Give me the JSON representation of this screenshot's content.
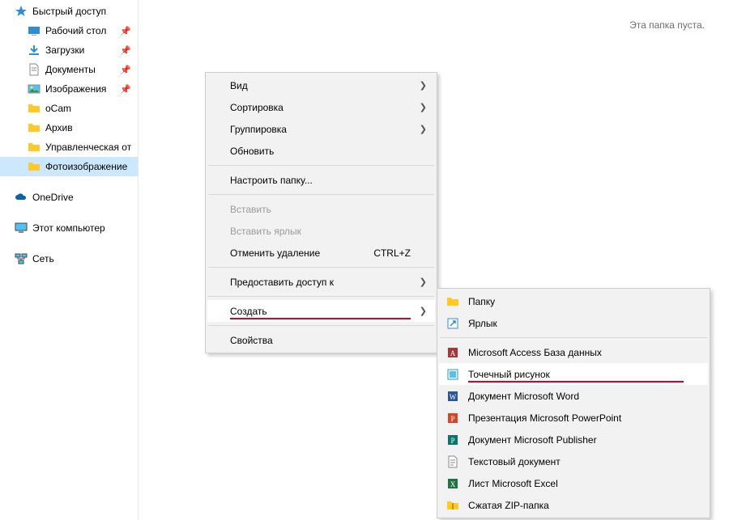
{
  "sidebar": {
    "quick_access": {
      "label": "Быстрый доступ"
    },
    "items": [
      {
        "label": "Рабочий стол",
        "pinned": true,
        "icon": "desktop"
      },
      {
        "label": "Загрузки",
        "pinned": true,
        "icon": "downloads"
      },
      {
        "label": "Документы",
        "pinned": true,
        "icon": "documents"
      },
      {
        "label": "Изображения",
        "pinned": true,
        "icon": "pictures"
      },
      {
        "label": "oCam",
        "pinned": false,
        "icon": "folder"
      },
      {
        "label": "Архив",
        "pinned": false,
        "icon": "folder"
      },
      {
        "label": "Управленческая от",
        "pinned": false,
        "icon": "folder"
      },
      {
        "label": "Фотоизображение",
        "pinned": false,
        "icon": "folder",
        "selected": true
      }
    ],
    "onedrive": {
      "label": "OneDrive"
    },
    "thispc": {
      "label": "Этот компьютер"
    },
    "network": {
      "label": "Сеть"
    }
  },
  "content": {
    "empty_message": "Эта папка пуста."
  },
  "context_menu": {
    "view": "Вид",
    "sort": "Сортировка",
    "group": "Группировка",
    "refresh": "Обновить",
    "customize": "Настроить папку...",
    "paste": "Вставить",
    "paste_shortcut": "Вставить ярлык",
    "undo_delete": "Отменить удаление",
    "undo_key": "CTRL+Z",
    "share_access": "Предоставить доступ к",
    "create": "Создать",
    "properties": "Свойства"
  },
  "submenu": {
    "folder": "Папку",
    "shortcut": "Ярлык",
    "access_db": "Microsoft Access База данных",
    "bitmap": "Точечный рисунок",
    "word": "Документ Microsoft Word",
    "powerpoint": "Презентация Microsoft PowerPoint",
    "publisher": "Документ Microsoft Publisher",
    "text": "Текстовый документ",
    "excel": "Лист Microsoft Excel",
    "zip": "Сжатая ZIP-папка"
  }
}
